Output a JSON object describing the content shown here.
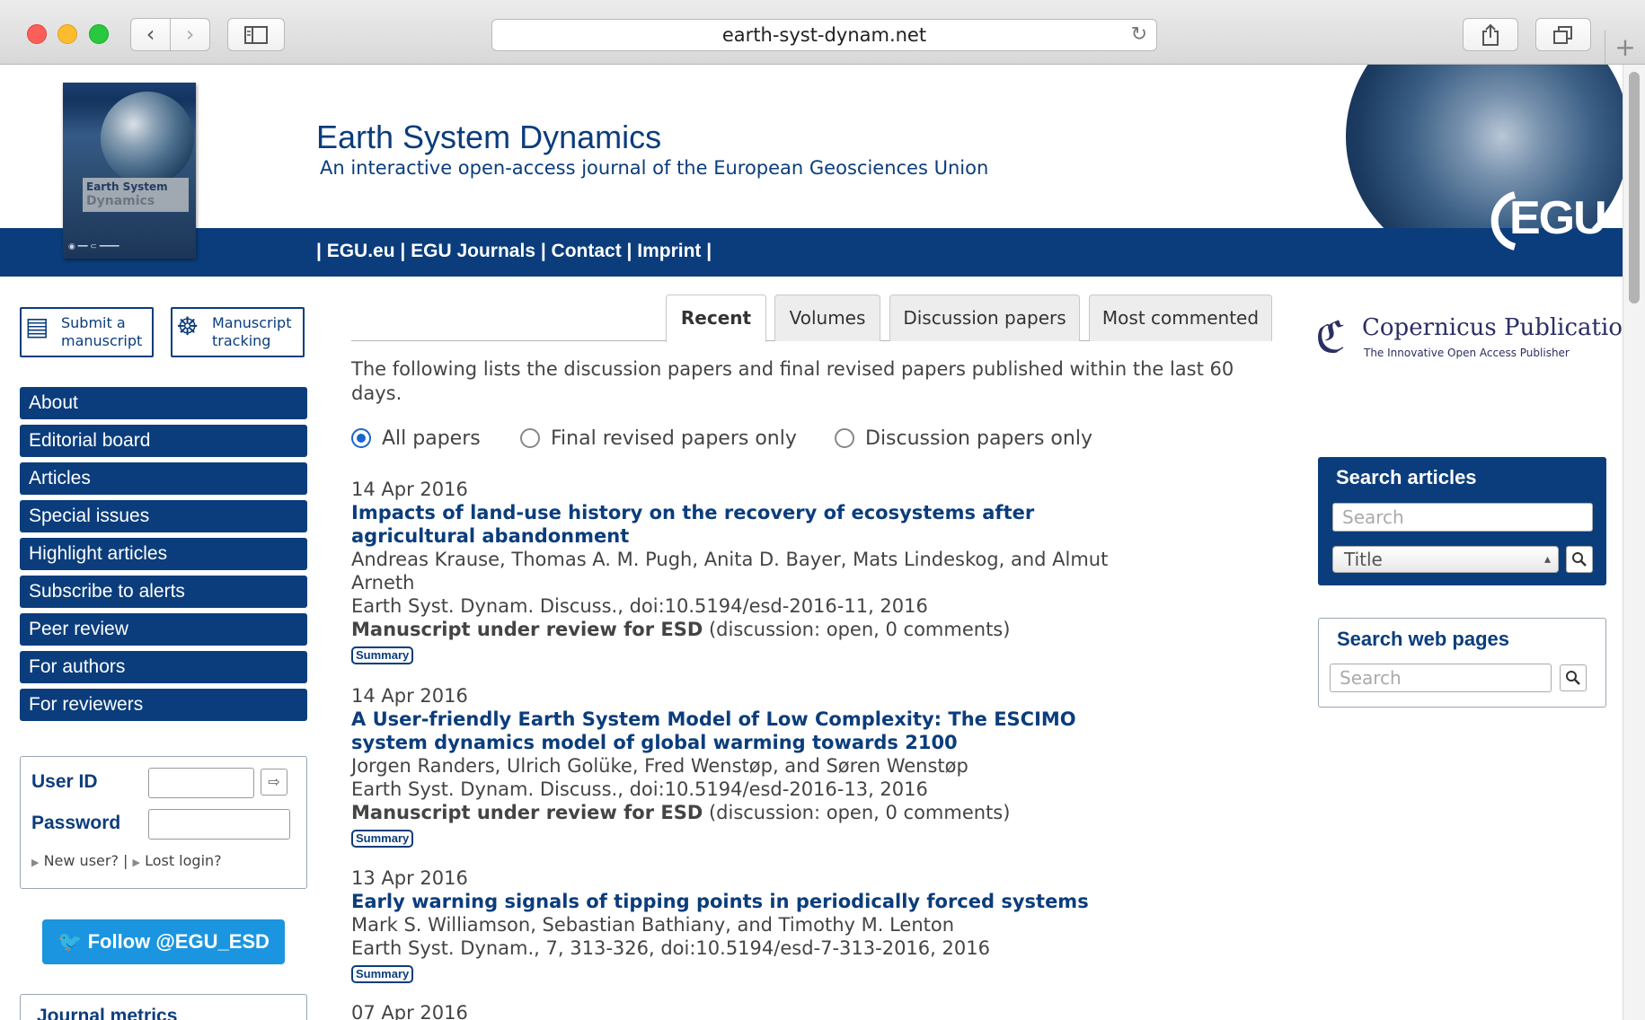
{
  "browser": {
    "url": "earth-syst-dynam.net",
    "back_icon": "chevron-left-icon",
    "forward_icon": "chevron-right-icon",
    "new_tab": "+"
  },
  "header": {
    "cover_title": "Earth System",
    "cover_subtitle": "Dynamics",
    "journal_title": "Earth System Dynamics",
    "journal_subtitle": "An interactive open-access journal of the European Geosciences Union",
    "links": [
      "EGU.eu",
      "EGU Journals",
      "Contact",
      "Imprint"
    ],
    "egu_logo": "EGU"
  },
  "sidebar": {
    "submit_line1": "Submit a",
    "submit_line2": "manuscript",
    "tracking_line1": "Manuscript",
    "tracking_line2": "tracking",
    "menu": [
      "About",
      "Editorial board",
      "Articles",
      "Special issues",
      "Highlight articles",
      "Subscribe to alerts",
      "Peer review",
      "For authors",
      "For reviewers"
    ],
    "login": {
      "user_label": "User ID",
      "password_label": "Password",
      "new_user": "New user?",
      "lost_login": "Lost login?"
    },
    "follow": "Follow @EGU_ESD",
    "metrics_title": "Journal metrics"
  },
  "main": {
    "tabs": [
      "Recent",
      "Volumes",
      "Discussion papers",
      "Most commented"
    ],
    "intro": "The following lists the discussion papers and final revised papers published within the last 60 days.",
    "filters": [
      "All papers",
      "Final revised papers only",
      "Discussion papers only"
    ],
    "summary_label": "Summary",
    "articles": [
      {
        "date": "14 Apr 2016",
        "title_l1": "Impacts of land-use history on the recovery of ecosystems after",
        "title_l2": "agricultural abandonment",
        "authors_l1": "Andreas Krause, Thomas A. M. Pugh, Anita D. Bayer, Mats Lindeskog, and Almut",
        "authors_l2": "Arneth",
        "citation": "Earth Syst. Dynam. Discuss., doi:10.5194/esd-2016-11, 2016",
        "status": "Manuscript under review for ESD",
        "discussion": " (discussion: open, 0 comments)"
      },
      {
        "date": "14 Apr 2016",
        "title_l1": "A User-friendly Earth System Model of Low Complexity: The ESCIMO",
        "title_l2": "system dynamics model of global warming towards 2100",
        "authors_l1": "Jorgen Randers, Ulrich Golüke, Fred Wenstøp, and Søren Wenstøp",
        "citation": "Earth Syst. Dynam. Discuss., doi:10.5194/esd-2016-13, 2016",
        "status": "Manuscript under review for ESD",
        "discussion": " (discussion: open, 0 comments)"
      },
      {
        "date": "13 Apr 2016",
        "title_l1": "Early warning signals of tipping points in periodically forced systems",
        "authors_l1": "Mark S. Williamson, Sebastian Bathiany, and Timothy M. Lenton",
        "citation": "Earth Syst. Dynam., 7, 313-326, doi:10.5194/esd-7-313-2016, 2016"
      },
      {
        "date": "07 Apr 2016"
      }
    ]
  },
  "right": {
    "publisher_name": "Copernicus Publications",
    "publisher_tagline": "The Innovative Open Access Publisher",
    "search_articles_title": "Search articles",
    "search_placeholder": "Search",
    "search_field_option": "Title",
    "search_web_title": "Search web pages"
  },
  "colors": {
    "brand": "#0b3d7c",
    "twitter": "#1b95e0"
  }
}
